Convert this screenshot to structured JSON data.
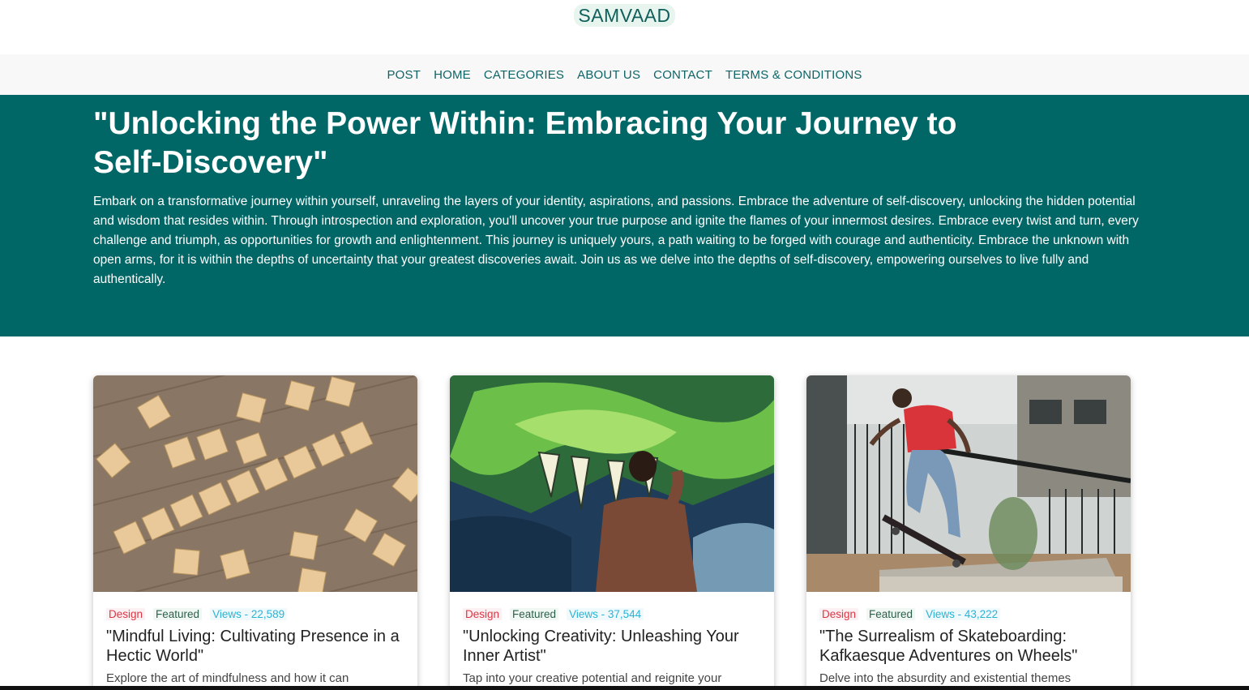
{
  "site": {
    "brand": "SAMVAAD"
  },
  "nav": {
    "items": [
      "POST",
      "HOME",
      "CATEGORIES",
      "ABOUT US",
      "CONTACT",
      "TERMS & CONDITIONS"
    ]
  },
  "hero": {
    "title": "\"Unlocking the Power Within: Embracing Your Journey to Self-Discovery\"",
    "text": "Embark on a transformative journey within yourself, unraveling the layers of your identity, aspirations, and passions. Embrace the adventure of self-discovery, unlocking the hidden potential and wisdom that resides within. Through introspection and exploration, you'll uncover your true purpose and ignite the flames of your innermost desires. Embrace every twist and turn, every challenge and triumph, as opportunities for growth and enlightenment. This journey is uniquely yours, a path waiting to be forged with courage and authenticity. Embrace the unknown with open arms, for it is within the depths of uncertainty that your greatest discoveries await. Join us as we delve into the depths of self-discovery, empowering ourselves to live fully and authentically."
  },
  "cards": [
    {
      "category": "Design",
      "tag": "Featured",
      "views": "Views - 22,589",
      "title": "\"Mindful Living: Cultivating Presence in a Hectic World\"",
      "excerpt": "Explore the art of mindfulness and how it can"
    },
    {
      "category": "Design",
      "tag": "Featured",
      "views": "Views - 37,544",
      "title": "\"Unlocking Creativity: Unleashing Your Inner Artist\"",
      "excerpt": "Tap into your creative potential and reignite your"
    },
    {
      "category": "Design",
      "tag": "Featured",
      "views": "Views - 43,222",
      "title": "\"The Surrealism of Skateboarding: Kafkaesque Adventures on Wheels\"",
      "excerpt": "Delve into the absurdity and existential themes"
    }
  ],
  "colors": {
    "brand": "#0f5f5c",
    "hero_bg": "#006666",
    "design_tag": "#dc3545",
    "views_tag": "#2bb3d4"
  }
}
